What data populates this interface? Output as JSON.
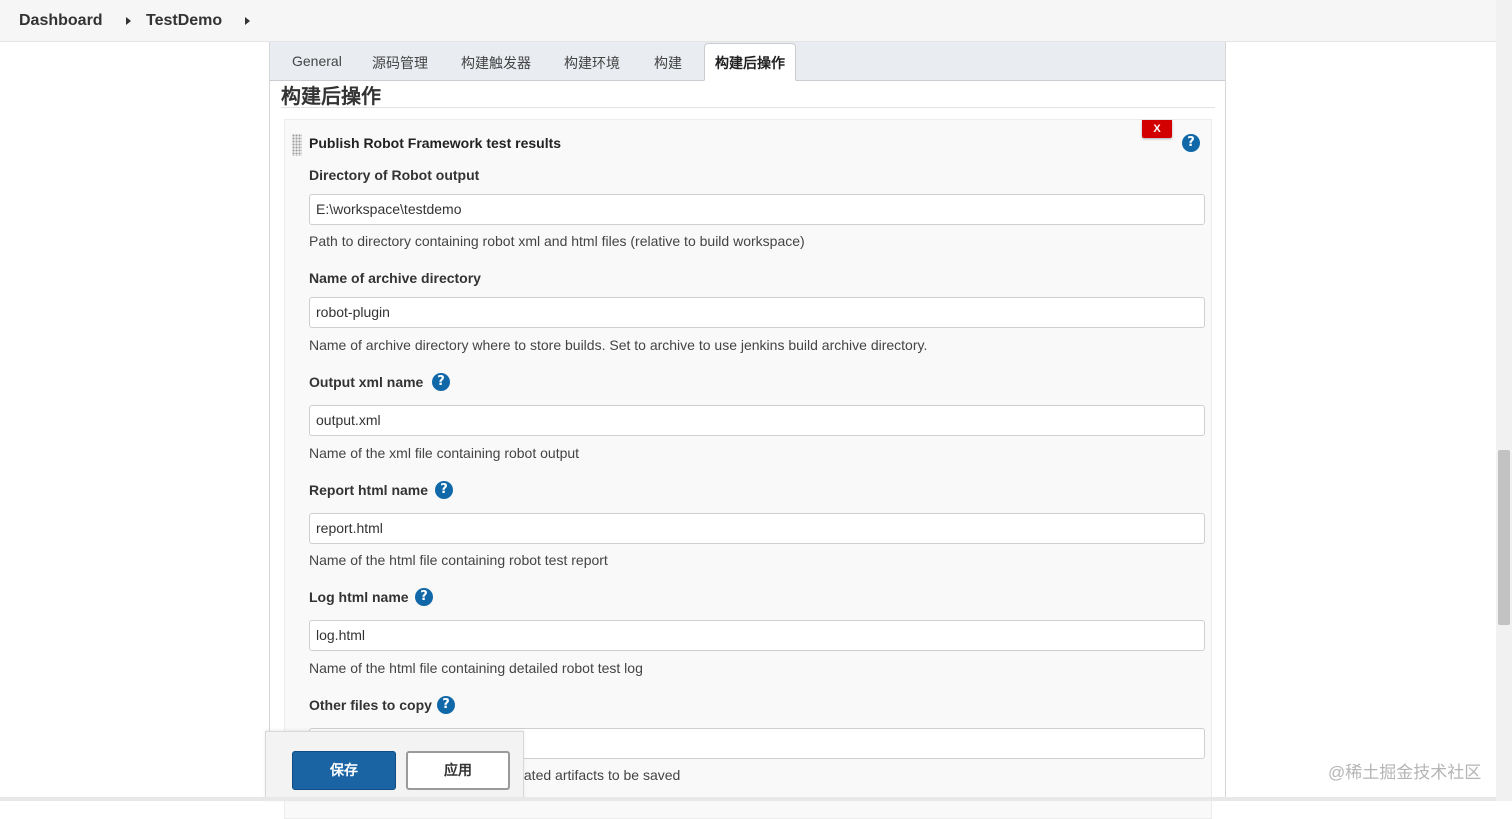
{
  "breadcrumb": {
    "items": [
      "Dashboard",
      "TestDemo"
    ]
  },
  "tabs": [
    {
      "label": "General"
    },
    {
      "label": "源码管理"
    },
    {
      "label": "构建触发器"
    },
    {
      "label": "构建环境"
    },
    {
      "label": "构建"
    },
    {
      "label": "构建后操作",
      "active": true
    }
  ],
  "section": {
    "title": "构建后操作"
  },
  "step": {
    "title": "Publish Robot Framework test results",
    "delete_label": "X",
    "help_glyph": "?",
    "fields": [
      {
        "label": "Directory of Robot output",
        "value": "E:\\workspace\\testdemo",
        "description": "Path to directory containing robot xml and html files (relative to build workspace)",
        "has_help": false
      },
      {
        "label": "Name of archive directory",
        "value": "robot-plugin",
        "description": "Name of archive directory where to store builds. Set to archive to use jenkins build archive directory.",
        "has_help": false
      },
      {
        "label": "Output xml name",
        "value": "output.xml",
        "description": "Name of the xml file containing robot output",
        "has_help": true
      },
      {
        "label": "Report html name",
        "value": "report.html",
        "description": "Name of the html file containing robot test report",
        "has_help": true
      },
      {
        "label": "Log html name",
        "value": "log.html",
        "description": "Name of the html file containing detailed robot test log",
        "has_help": true
      },
      {
        "label": "Other files to copy",
        "value": "",
        "description": "elated artifacts to be saved",
        "has_help": true
      }
    ]
  },
  "savebar": {
    "save_label": "保存",
    "apply_label": "应用"
  },
  "watermark": "@稀土掘金技术社区",
  "colors": {
    "primary": "#1a64a4",
    "danger": "#d20000",
    "help": "#1168a8"
  },
  "icons": [
    "chevron-right-icon",
    "drag-handle-icon",
    "help-icon",
    "close-icon"
  ]
}
